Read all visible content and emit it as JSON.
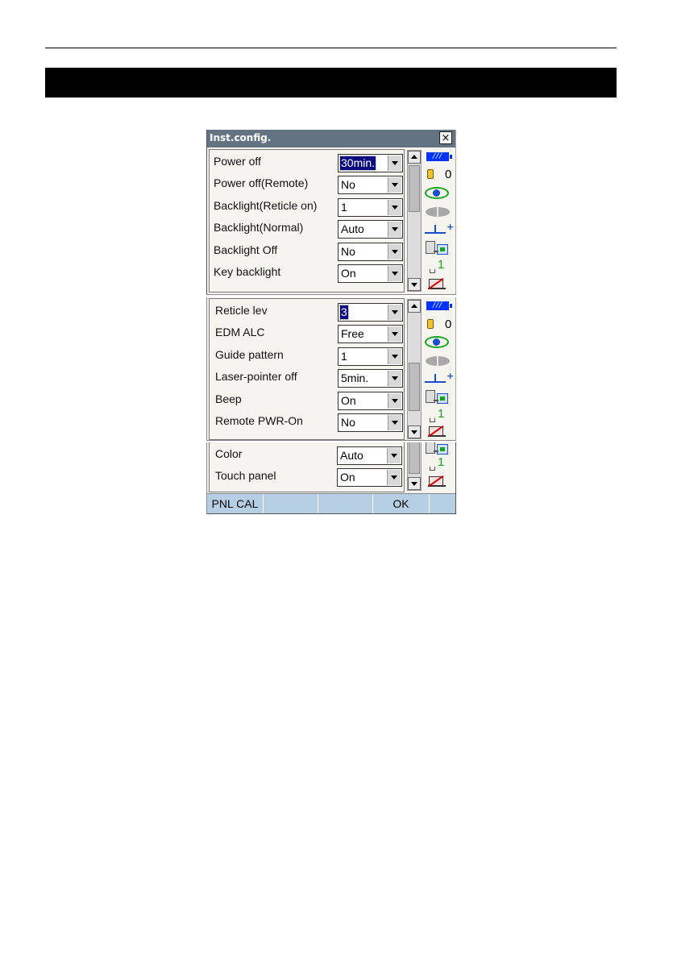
{
  "window": {
    "title": "Inst.config.",
    "close_glyph": "×"
  },
  "screen1": {
    "rows": [
      {
        "label": "Power off",
        "value": "30min.",
        "selected": true
      },
      {
        "label": "Power off(Remote)",
        "value": "No"
      },
      {
        "label": "Backlight(Reticle on)",
        "value": "1"
      },
      {
        "label": "Backlight(Normal)",
        "value": "Auto"
      },
      {
        "label": "Backlight Off",
        "value": "No"
      },
      {
        "label": "Key backlight",
        "value": "On"
      }
    ]
  },
  "screen2": {
    "rows": [
      {
        "label": "Reticle lev",
        "value": "3",
        "selected": true
      },
      {
        "label": "EDM ALC",
        "value": "Free"
      },
      {
        "label": "Guide pattern",
        "value": "1"
      },
      {
        "label": "Laser-pointer off",
        "value": "5min."
      },
      {
        "label": "Beep",
        "value": "On"
      },
      {
        "label": "Remote PWR-On",
        "value": "No"
      }
    ]
  },
  "screen3": {
    "rows": [
      {
        "label": "Color",
        "value": "Auto"
      },
      {
        "label": "Touch panel",
        "value": "On"
      }
    ]
  },
  "status": {
    "battery_glyph": "///",
    "prism_constant": "0",
    "channel": "1",
    "icons": [
      "battery-icon",
      "prism-icon",
      "tilt-icon",
      "telescope-icon",
      "target-icon",
      "controller-icon",
      "channel-icon",
      "memory-card-icon"
    ]
  },
  "softkeys": [
    "PNL CAL",
    "",
    "",
    "OK",
    ""
  ],
  "colors": {
    "titlebar": "#647383",
    "softkey_bar": "#b7cfe4",
    "selection": "#0a0a80",
    "battery": "#0033ff",
    "accent_green": "#17a317"
  }
}
